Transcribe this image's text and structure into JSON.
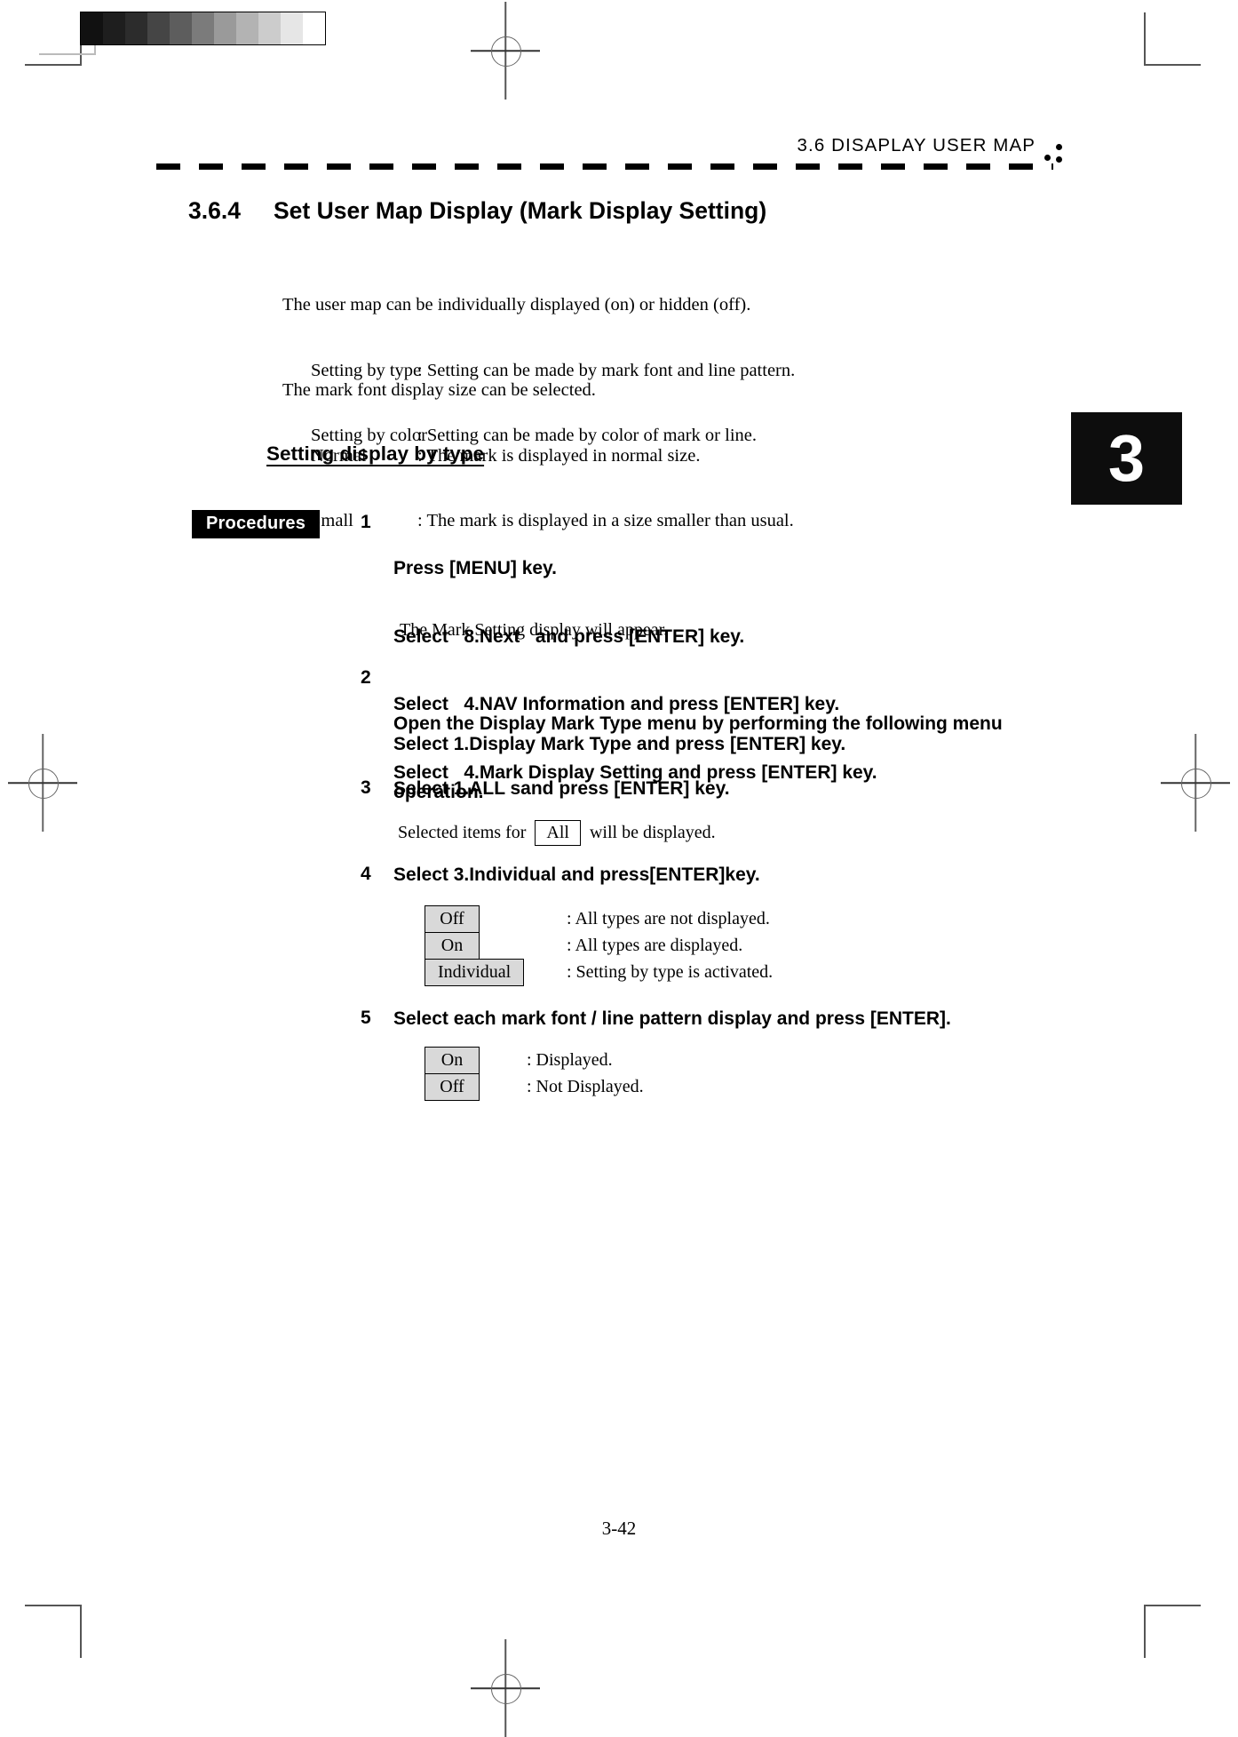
{
  "scan": {
    "grayscale_steps": [
      "#111111",
      "#1e1e1e",
      "#2c2c2c",
      "#454545",
      "#5d5d5d",
      "#7b7b7b",
      "#9a9a9a",
      "#b3b3b3",
      "#cccccc",
      "#e6e6e6",
      "#ffffff"
    ]
  },
  "header": {
    "running_title": "3.6   DISAPLAY  USER  MAP"
  },
  "chapter_tab": {
    "number": "3"
  },
  "section": {
    "number": "3.6.4",
    "title": "Set User Map Display (Mark Display Setting)"
  },
  "intro": {
    "block1_lead": "The user map can be individually displayed (on) or hidden (off).",
    "block1_rows": [
      {
        "label": "Setting by type",
        "desc": ": Setting can be made by mark font and line pattern."
      },
      {
        "label": "Setting by color",
        "desc": ": Setting can be made by color of mark or line."
      }
    ],
    "block2_lead": "The mark font display size can be selected.",
    "block2_rows": [
      {
        "label": "Normal",
        "desc": ": The mark is displayed in normal size."
      },
      {
        "label": "Small",
        "desc": ": The mark is displayed in a size smaller than usual."
      }
    ]
  },
  "subhead": "Setting display by type",
  "procedures_badge": "Procedures",
  "steps": [
    {
      "number": "1",
      "lines": [
        "Press [MENU] key.",
        "Select   8.Next   and press [ENTER] key.",
        "Select   4.NAV Information and press [ENTER] key.",
        "Select   4.Mark Display Setting and press [ENTER] key."
      ],
      "note": "The Mark Setting display will appear."
    },
    {
      "number": "2",
      "lines": [
        "Open the Display Mark Type menu by performing the following menu",
        "operation."
      ],
      "sub_bold": "Select 1.Display Mark Type and press [ENTER] key."
    },
    {
      "number": "3",
      "lines": [
        "Select 1.ALL sand press [ENTER] key."
      ],
      "inline_note": {
        "before": "Selected items for",
        "tag": "All",
        "after": "will be displayed."
      }
    },
    {
      "number": "4",
      "lines": [
        "Select 3.Individual and press[ENTER]key."
      ],
      "options": [
        {
          "tag": "Off",
          "desc": ": All types are not displayed."
        },
        {
          "tag": "On",
          "desc": ": All types are displayed."
        },
        {
          "tag": "Individual",
          "desc": ": Setting by type is activated."
        }
      ]
    },
    {
      "number": "5",
      "lines": [
        "Select each mark font / line pattern display and press [ENTER]."
      ],
      "options": [
        {
          "tag": "On",
          "desc": ": Displayed."
        },
        {
          "tag": "Off",
          "desc": ": Not Displayed."
        }
      ]
    }
  ],
  "page_number": "3-42"
}
